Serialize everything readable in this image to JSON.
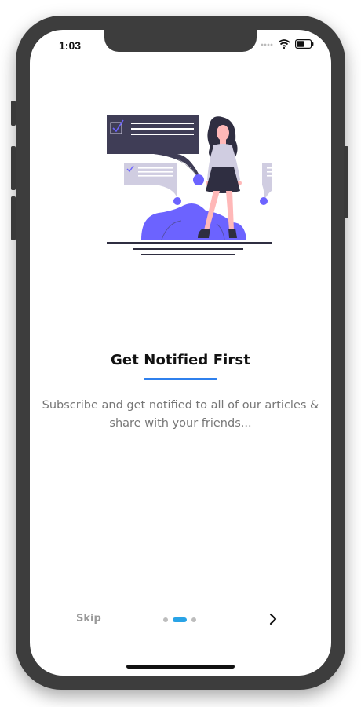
{
  "status_bar": {
    "time": "1:03"
  },
  "illustration": {
    "name": "notification-illustration",
    "colors": {
      "dark_panel": "#3f3d56",
      "accent_purple": "#6c63ff",
      "light_panel": "#d0cde1",
      "skin": "#ffb8b8",
      "hair": "#2f2e41"
    }
  },
  "onboarding": {
    "title": "Get Notified First",
    "description": "Subscribe and get notified to all of our articles & share with your friends...",
    "accent_color": "#2f80ed"
  },
  "navigation": {
    "skip_label": "Skip",
    "next_icon": "chevron-right-icon",
    "pages_total": 3,
    "current_page": 2
  }
}
